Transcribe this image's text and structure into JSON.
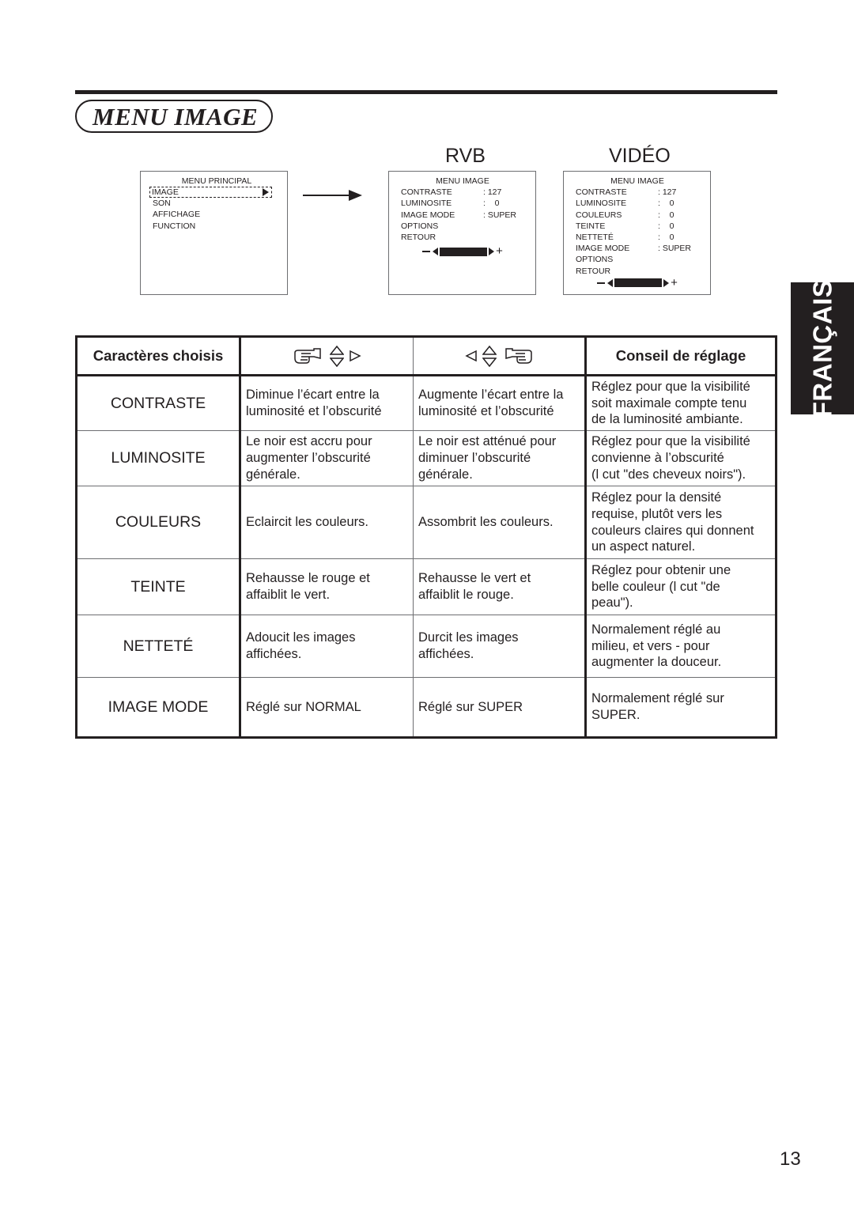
{
  "page": {
    "title": "MENU IMAGE",
    "side_tab": "FRANÇAIS",
    "page_number": "13"
  },
  "columns": {
    "rgb": "RVB",
    "video": "VIDÉO"
  },
  "osd_main": {
    "header": "MENU PRINCIPAL",
    "items": [
      "IMAGE",
      "SON",
      "AFFICHAGE",
      "FUNCTION"
    ],
    "selected_index": 0
  },
  "osd_rgb": {
    "header": "MENU IMAGE",
    "rows": [
      {
        "label": "CONTRASTE",
        "value": ": 127"
      },
      {
        "label": "LUMINOSITE",
        "value": ":    0"
      },
      {
        "label": "IMAGE MODE",
        "value": ": SUPER"
      },
      {
        "label": "OPTIONS",
        "value": ""
      },
      {
        "label": "RETOUR",
        "value": ""
      }
    ],
    "slider": {
      "minus": "−",
      "plus": "+"
    }
  },
  "osd_video": {
    "header": "MENU IMAGE",
    "rows": [
      {
        "label": "CONTRASTE",
        "value": ": 127"
      },
      {
        "label": "LUMINOSITE",
        "value": ":    0"
      },
      {
        "label": "COULEURS",
        "value": ":    0"
      },
      {
        "label": "TEINTE",
        "value": ":    0"
      },
      {
        "label": "NETTETÉ",
        "value": ":    0"
      },
      {
        "label": "IMAGE MODE",
        "value": ": SUPER"
      },
      {
        "label": "OPTIONS",
        "value": ""
      },
      {
        "label": "RETOUR",
        "value": ""
      }
    ],
    "slider": {
      "minus": "−",
      "plus": "+"
    }
  },
  "table": {
    "headers": {
      "item": "Caractères choisis",
      "decrease_icons": [
        "pointing-hand-right",
        "up-down-triangles",
        "right-triangle"
      ],
      "increase_icons": [
        "left-triangle",
        "up-down-triangles",
        "pointing-hand-left"
      ],
      "advice": "Conseil de réglage"
    },
    "rows": [
      {
        "name": "CONTRASTE",
        "decrease": [
          "Diminue l’écart entre la",
          "luminosité et l’obscurité"
        ],
        "increase": [
          "Augmente l’écart entre la",
          "luminosité et l’obscurité"
        ],
        "advice": [
          "Réglez pour que la visibilité",
          "soit maximale compte tenu",
          "de la luminosité ambiante."
        ]
      },
      {
        "name": "LUMINOSITE",
        "decrease": [
          "Le noir est accru pour",
          "augmenter l’obscurité",
          "générale."
        ],
        "increase": [
          "Le noir est atténué pour",
          "diminuer l’obscurité",
          "générale."
        ],
        "advice": [
          "Réglez pour que la visibilité",
          "convienne à l’obscurité",
          "(l cut \"des cheveux noirs\")."
        ]
      },
      {
        "name": "COULEURS",
        "decrease": [
          "Eclaircit les couleurs."
        ],
        "increase": [
          "Assombrit les couleurs."
        ],
        "advice": [
          "Réglez pour la densité",
          "requise, plutôt vers les",
          "couleurs claires qui donnent",
          "un aspect naturel."
        ]
      },
      {
        "name": "TEINTE",
        "decrease": [
          "Rehausse le rouge et",
          "affaiblit le vert."
        ],
        "increase": [
          "Rehausse le vert et",
          "affaiblit le rouge."
        ],
        "advice": [
          "Réglez pour obtenir une",
          "belle couleur (l cut \"de",
          "peau\")."
        ]
      },
      {
        "name": "NETTETÉ",
        "decrease": [
          "Adoucit les images",
          "affichées."
        ],
        "increase": [
          "Durcit les images",
          "affichées."
        ],
        "advice": [
          "Normalement réglé au",
          "milieu, et vers - pour",
          "augmenter la douceur."
        ]
      },
      {
        "name": "IMAGE MODE",
        "decrease": [
          "Réglé sur NORMAL"
        ],
        "increase": [
          "Réglé sur SUPER"
        ],
        "advice": [
          "Normalement réglé sur",
          "SUPER."
        ]
      }
    ]
  }
}
